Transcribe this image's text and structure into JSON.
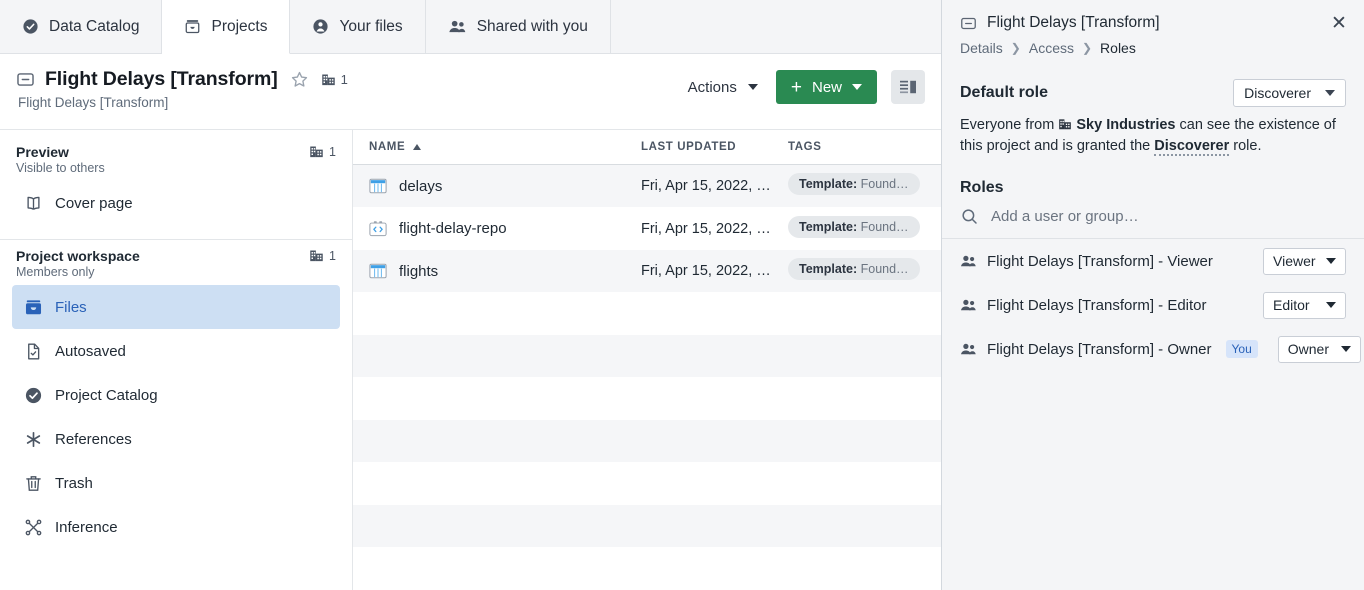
{
  "topnav": {
    "tabs": [
      {
        "label": "Data Catalog",
        "icon": "check-badge-icon",
        "active": false
      },
      {
        "label": "Projects",
        "icon": "archive-box-icon",
        "active": true
      },
      {
        "label": "Your files",
        "icon": "person-circle-icon",
        "active": false
      },
      {
        "label": "Shared with you",
        "icon": "people-icon",
        "active": false
      }
    ]
  },
  "project_header": {
    "title": "Flight Delays [Transform]",
    "subtitle": "Flight Delays [Transform]",
    "org_count": "1",
    "actions_label": "Actions",
    "new_label": "New",
    "plus": "+"
  },
  "sidebar": {
    "sections": [
      {
        "title": "Preview",
        "subtitle": "Visible to others",
        "count": "1",
        "items": [
          {
            "label": "Cover page",
            "icon": "book-open-icon",
            "selected": false
          }
        ]
      },
      {
        "title": "Project workspace",
        "subtitle": "Members only",
        "count": "1",
        "items": [
          {
            "label": "Files",
            "icon": "archive-box-icon",
            "selected": true
          },
          {
            "label": "Autosaved",
            "icon": "document-check-icon",
            "selected": false
          },
          {
            "label": "Project Catalog",
            "icon": "check-badge-icon",
            "selected": false
          },
          {
            "label": "References",
            "icon": "asterisk-icon",
            "selected": false
          },
          {
            "label": "Trash",
            "icon": "trash-icon",
            "selected": false
          },
          {
            "label": "Inference",
            "icon": "graph-nodes-icon",
            "selected": false
          }
        ]
      }
    ]
  },
  "file_table": {
    "columns": [
      "NAME",
      "LAST UPDATED",
      "TAGS"
    ],
    "sort_column": "NAME",
    "sort_direction": "asc",
    "rows": [
      {
        "name": "delays",
        "icon": "table-icon",
        "last_updated": "Fri, Apr 15, 2022, …",
        "tag_label": "Template:",
        "tag_value": "Found…"
      },
      {
        "name": "flight-delay-repo",
        "icon": "code-repo-icon",
        "last_updated": "Fri, Apr 15, 2022, …",
        "tag_label": "Template:",
        "tag_value": "Found…"
      },
      {
        "name": "flights",
        "icon": "table-icon",
        "last_updated": "Fri, Apr 15, 2022, …",
        "tag_label": "Template:",
        "tag_value": "Found…"
      }
    ],
    "empty_row_count": 7
  },
  "right_panel": {
    "title": "Flight Delays [Transform]",
    "close_label": "✕",
    "breadcrumb": [
      "Details",
      "Access",
      "Roles"
    ],
    "breadcrumb_separator": "❯",
    "default_role": {
      "heading": "Default role",
      "selected": "Discoverer",
      "description_prefix": "Everyone from ",
      "org_name": "Sky Industries",
      "description_middle": " can see the existence of this project and is granted the ",
      "role_link": "Discoverer",
      "description_suffix": " role."
    },
    "roles": {
      "heading": "Roles",
      "search_placeholder": "Add a user or group…",
      "entries": [
        {
          "name": "Flight Delays [Transform] - Viewer",
          "badge": "",
          "role": "Viewer"
        },
        {
          "name": "Flight Delays [Transform] - Editor",
          "badge": "",
          "role": "Editor"
        },
        {
          "name": "Flight Delays [Transform] - Owner",
          "badge": "You",
          "role": "Owner"
        }
      ]
    }
  },
  "colors": {
    "accent_green": "#2a8a52",
    "accent_blue": "#2a62b8",
    "selected_bg": "#cddff3",
    "panel_bg": "#f4f5f7",
    "row_stripe": "#f5f6f8"
  }
}
